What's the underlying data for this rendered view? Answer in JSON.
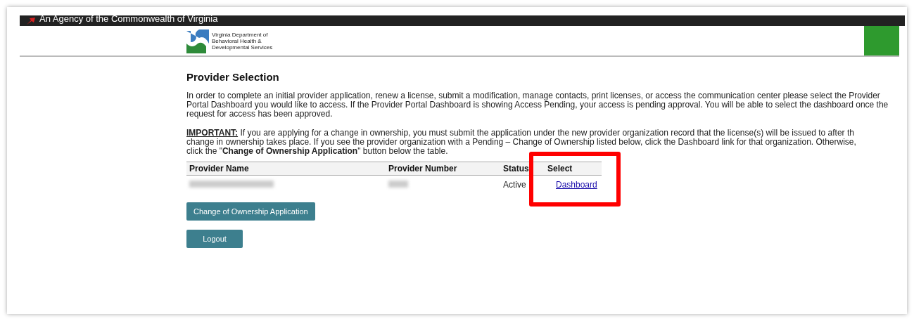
{
  "banner": {
    "text": "An Agency of the Commonwealth of Virginia"
  },
  "logo": {
    "lines": [
      "Virginia Department of",
      "Behavioral Health &",
      "Developmental Services"
    ]
  },
  "heading": "Provider Selection",
  "intro": "In order to complete an initial provider application, renew a license, submit a modification, manage contacts, print licenses, or access the communication center please select the Provider Portal Dashboard you would like to access. If the Provider Portal Dashboard is showing Access Pending, your access is pending approval. You will be able to select the dashboard once the request for access has been approved.",
  "important_lines": [
    "**IMPORTANT:** If you are applying for a change in ownership, you must submit the application under the new provider organization record that the license(s) will be issued to after th",
    "change in ownership takes place. If you see the provider organization with a Pending – Change of Ownership listed below, click the Dashboard link for that organization. Otherwise,",
    "click the \"**Change of Ownership Application**\" button below the table."
  ],
  "table": {
    "columns": [
      "Provider Name",
      "Provider Number",
      "Status",
      "Select"
    ],
    "rows": [
      {
        "status": "Active",
        "link": "Dashboard"
      }
    ]
  },
  "buttons": [
    "Change of Ownership Application",
    "Logout"
  ]
}
